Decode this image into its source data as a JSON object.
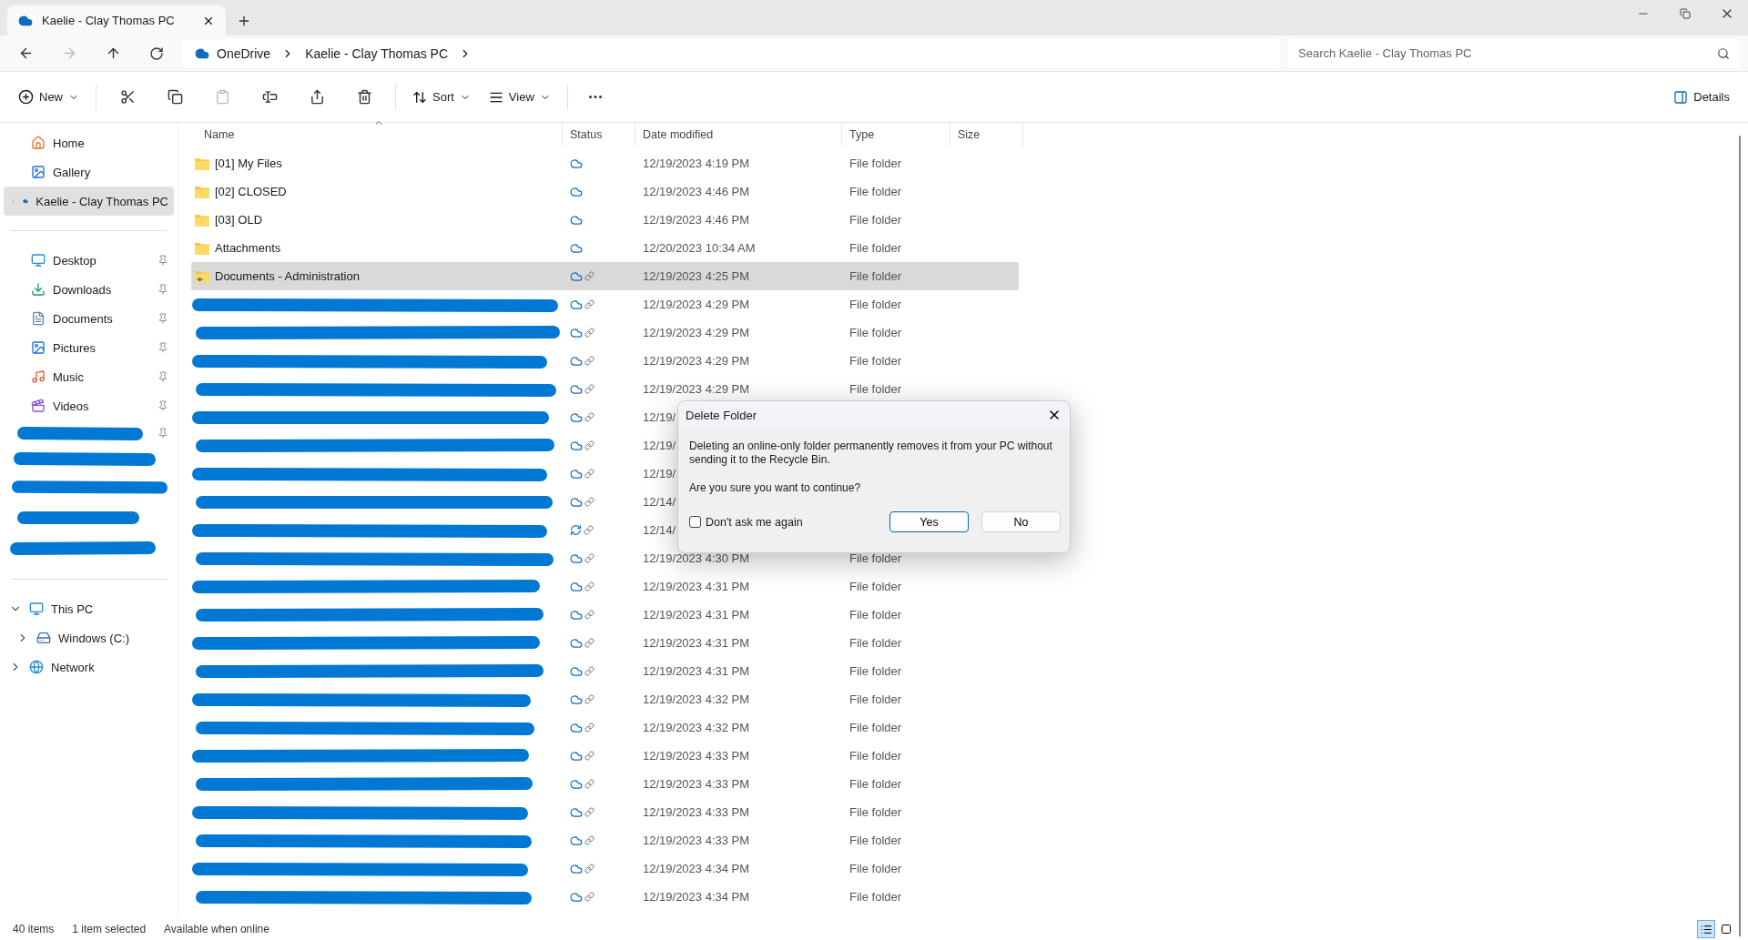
{
  "tab": {
    "title": "Kaelie - Clay Thomas PC"
  },
  "nav": [
    {
      "kind": "back",
      "disabled": false
    },
    {
      "kind": "forward",
      "disabled": true
    },
    {
      "kind": "up",
      "disabled": false
    },
    {
      "kind": "refresh",
      "disabled": false
    }
  ],
  "breadcrumb": [
    {
      "label": "OneDrive",
      "kind": "cloud"
    },
    {
      "label": "Kaelie - Clay Thomas PC",
      "kind": "plain"
    }
  ],
  "search": {
    "placeholder": "Search Kaelie - Clay Thomas PC"
  },
  "toolbar": {
    "new": "New",
    "sort": "Sort",
    "view": "View",
    "details": "Details",
    "icons": [
      {
        "kind": "cut",
        "disabled": false
      },
      {
        "kind": "copy",
        "disabled": false
      },
      {
        "kind": "paste",
        "disabled": true
      },
      {
        "kind": "rename",
        "disabled": false
      },
      {
        "kind": "share",
        "disabled": false
      },
      {
        "kind": "delete",
        "disabled": false
      }
    ]
  },
  "sidebar": {
    "top": [
      {
        "label": "Home",
        "kind": "home",
        "selected": false
      },
      {
        "label": "Gallery",
        "kind": "gallery",
        "selected": false
      },
      {
        "label": "Kaelie - Clay Thomas PC",
        "kind": "onedrive",
        "selected": true
      }
    ],
    "quick_access": [
      {
        "label": "Desktop",
        "kind": "desktop",
        "pinned": true
      },
      {
        "label": "Downloads",
        "kind": "downloads",
        "pinned": true
      },
      {
        "label": "Documents",
        "kind": "documents",
        "pinned": true
      },
      {
        "label": "Pictures",
        "kind": "pictures",
        "pinned": true
      },
      {
        "label": "Music",
        "kind": "music",
        "pinned": true
      },
      {
        "label": "Videos",
        "kind": "videos",
        "pinned": true
      },
      {
        "kind": "redacted",
        "pinned": true
      },
      {
        "kind": "redacted",
        "pinned": false
      },
      {
        "kind": "redacted",
        "pinned": false
      },
      {
        "kind": "redacted",
        "pinned": false
      },
      {
        "kind": "redacted",
        "pinned": false
      }
    ],
    "devices": [
      {
        "label": "This PC",
        "kind": "pc",
        "expanded": true,
        "children": [
          {
            "label": "Windows (C:)",
            "kind": "drive",
            "expanded": false
          }
        ]
      },
      {
        "label": "Network",
        "kind": "network",
        "expanded": false
      }
    ]
  },
  "columns": [
    {
      "label": "Name",
      "sorted": true
    },
    {
      "label": "Status",
      "sorted": false
    },
    {
      "label": "Date modified",
      "sorted": false
    },
    {
      "label": "Type",
      "sorted": false
    },
    {
      "label": "Size",
      "sorted": false
    }
  ],
  "rows": [
    {
      "kind": "folder",
      "name": "[01] My Files",
      "status": {
        "kind": "cloud",
        "linked": false
      },
      "date": "12/19/2023 4:19 PM",
      "type": "File folder",
      "selected": false
    },
    {
      "kind": "folder",
      "name": "[02] CLOSED",
      "status": {
        "kind": "cloud",
        "linked": false
      },
      "date": "12/19/2023 4:46 PM",
      "type": "File folder",
      "selected": false
    },
    {
      "kind": "folder",
      "name": "[03] OLD",
      "status": {
        "kind": "cloud",
        "linked": false
      },
      "date": "12/19/2023 4:46 PM",
      "type": "File folder",
      "selected": false
    },
    {
      "kind": "folder",
      "name": "Attachments",
      "status": {
        "kind": "cloud",
        "linked": false
      },
      "date": "12/20/2023 10:34 AM",
      "type": "File folder",
      "selected": false
    },
    {
      "kind": "shared",
      "name": "Documents - Administration",
      "status": {
        "kind": "cloud",
        "linked": true
      },
      "date": "12/19/2023 4:25 PM",
      "type": "File folder",
      "selected": true
    },
    {
      "kind": "redacted",
      "status": {
        "kind": "cloud",
        "linked": true
      },
      "date": "12/19/2023 4:29 PM",
      "type": "File folder",
      "selected": false
    },
    {
      "kind": "redacted",
      "status": {
        "kind": "cloud",
        "linked": true
      },
      "date": "12/19/2023 4:29 PM",
      "type": "File folder",
      "selected": false
    },
    {
      "kind": "redacted",
      "status": {
        "kind": "cloud",
        "linked": true
      },
      "date": "12/19/2023 4:29 PM",
      "type": "File folder",
      "selected": false
    },
    {
      "kind": "redacted",
      "status": {
        "kind": "cloud",
        "linked": true
      },
      "date": "12/19/2023 4:29 PM",
      "type": "File folder",
      "selected": false
    },
    {
      "kind": "redacted",
      "status": {
        "kind": "cloud",
        "linked": true
      },
      "date": "12/19/",
      "selected": false
    },
    {
      "kind": "redacted",
      "status": {
        "kind": "cloud",
        "linked": true
      },
      "date": "12/19/",
      "selected": false
    },
    {
      "kind": "redacted",
      "status": {
        "kind": "cloud",
        "linked": true
      },
      "date": "12/19/",
      "selected": false
    },
    {
      "kind": "redacted",
      "status": {
        "kind": "cloud",
        "linked": true
      },
      "date": "12/14/",
      "selected": false
    },
    {
      "kind": "redacted",
      "status": {
        "kind": "sync",
        "linked": true
      },
      "date": "12/14/",
      "selected": false
    },
    {
      "kind": "redacted",
      "status": {
        "kind": "cloud",
        "linked": true
      },
      "date": "12/19/2023 4:30 PM",
      "type": "File folder",
      "selected": false
    },
    {
      "kind": "redacted",
      "status": {
        "kind": "cloud",
        "linked": true
      },
      "date": "12/19/2023 4:31 PM",
      "type": "File folder",
      "selected": false
    },
    {
      "kind": "redacted",
      "status": {
        "kind": "cloud",
        "linked": true
      },
      "date": "12/19/2023 4:31 PM",
      "type": "File folder",
      "selected": false
    },
    {
      "kind": "redacted",
      "status": {
        "kind": "cloud",
        "linked": true
      },
      "date": "12/19/2023 4:31 PM",
      "type": "File folder",
      "selected": false
    },
    {
      "kind": "redacted",
      "status": {
        "kind": "cloud",
        "linked": true
      },
      "date": "12/19/2023 4:31 PM",
      "type": "File folder",
      "selected": false
    },
    {
      "kind": "redacted",
      "status": {
        "kind": "cloud",
        "linked": true
      },
      "date": "12/19/2023 4:32 PM",
      "type": "File folder",
      "selected": false
    },
    {
      "kind": "redacted",
      "status": {
        "kind": "cloud",
        "linked": true
      },
      "date": "12/19/2023 4:32 PM",
      "type": "File folder",
      "selected": false
    },
    {
      "kind": "redacted",
      "status": {
        "kind": "cloud",
        "linked": true
      },
      "date": "12/19/2023 4:33 PM",
      "type": "File folder",
      "selected": false
    },
    {
      "kind": "redacted",
      "status": {
        "kind": "cloud",
        "linked": true
      },
      "date": "12/19/2023 4:33 PM",
      "type": "File folder",
      "selected": false
    },
    {
      "kind": "redacted",
      "status": {
        "kind": "cloud",
        "linked": true
      },
      "date": "12/19/2023 4:33 PM",
      "type": "File folder",
      "selected": false
    },
    {
      "kind": "redacted",
      "status": {
        "kind": "cloud",
        "linked": true
      },
      "date": "12/19/2023 4:33 PM",
      "type": "File folder",
      "selected": false
    },
    {
      "kind": "redacted",
      "status": {
        "kind": "cloud",
        "linked": true
      },
      "date": "12/19/2023 4:34 PM",
      "type": "File folder",
      "selected": false
    },
    {
      "kind": "redacted",
      "status": {
        "kind": "cloud",
        "linked": true
      },
      "date": "12/19/2023 4:34 PM",
      "type": "File folder",
      "selected": false
    }
  ],
  "dialog": {
    "title": "Delete Folder",
    "message": "Deleting an online-only folder permanently removes it from your PC without sending it to the Recycle Bin.",
    "question": "Are you sure you want to continue?",
    "checkbox": {
      "label": "Don't ask me again",
      "checked": false
    },
    "buttons": [
      {
        "label": "Yes",
        "default": true
      },
      {
        "label": "No",
        "default": false
      }
    ]
  },
  "status_bar": {
    "items": [
      "40 items",
      "1 item selected",
      "Available when online"
    ],
    "views": [
      {
        "kind": "details",
        "selected": true
      },
      {
        "kind": "tiles",
        "selected": false
      }
    ]
  }
}
